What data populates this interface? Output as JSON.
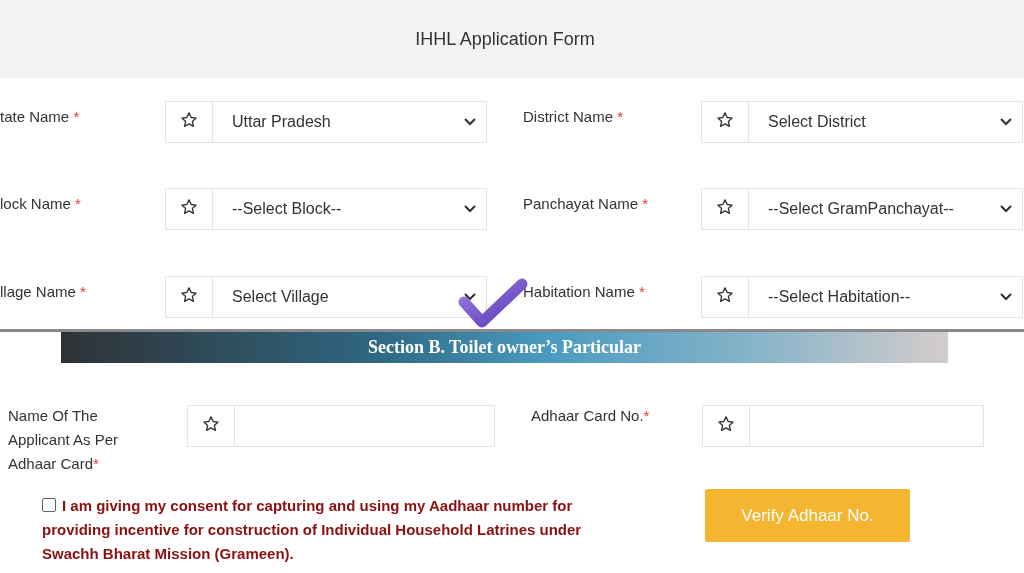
{
  "header": {
    "title": "IHHL Application Form"
  },
  "location_fields": [
    {
      "label": "tate Name",
      "mark": "*",
      "value": "Uttar Pradesh"
    },
    {
      "label": "District Name",
      "mark": "*",
      "value": "Select District"
    },
    {
      "label": "lock Name",
      "mark": "*",
      "value": "--Select Block--"
    },
    {
      "label": "Panchayat Name",
      "mark": "*",
      "value": "--Select GramPanchayat--"
    },
    {
      "label": "llage Name",
      "mark": "*",
      "value": "Select Village"
    },
    {
      "label": "Habitation Name",
      "mark": "*",
      "value": "--Select Habitation--"
    }
  ],
  "section_b": {
    "title": "Section B. Toilet owner’s Particular",
    "fields": [
      {
        "label": "Name Of The Applicant As Per Adhaar Card",
        "mark": "*"
      },
      {
        "label": "Adhaar Card No.",
        "mark": "*"
      }
    ],
    "consent": {
      "checked": false,
      "text": "I am giving my consent for capturing and using my Aadhaar number for providing incentive for construction of Individual Household Latrines under Swachh Bharat Mission (Grameen)."
    },
    "verify_button": "Verify Adhaar No."
  }
}
